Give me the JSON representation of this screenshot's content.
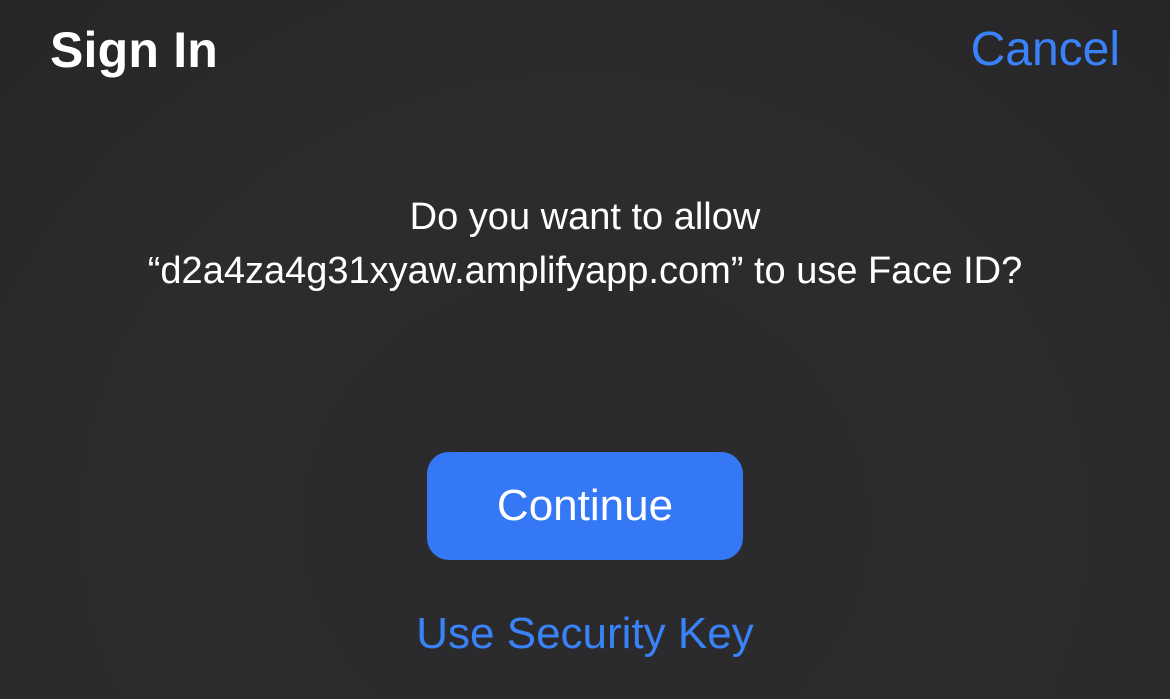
{
  "header": {
    "title": "Sign In",
    "cancel_label": "Cancel"
  },
  "prompt": {
    "line1": "Do you want to allow",
    "line2": "“d2a4za4g31xyaw.amplifyapp.com” to use Face ID?"
  },
  "actions": {
    "continue_label": "Continue",
    "security_key_label": "Use Security Key"
  },
  "colors": {
    "background": "#2c2c2e",
    "accent": "#3a82f7",
    "button": "#3478f6",
    "text": "#ffffff"
  }
}
